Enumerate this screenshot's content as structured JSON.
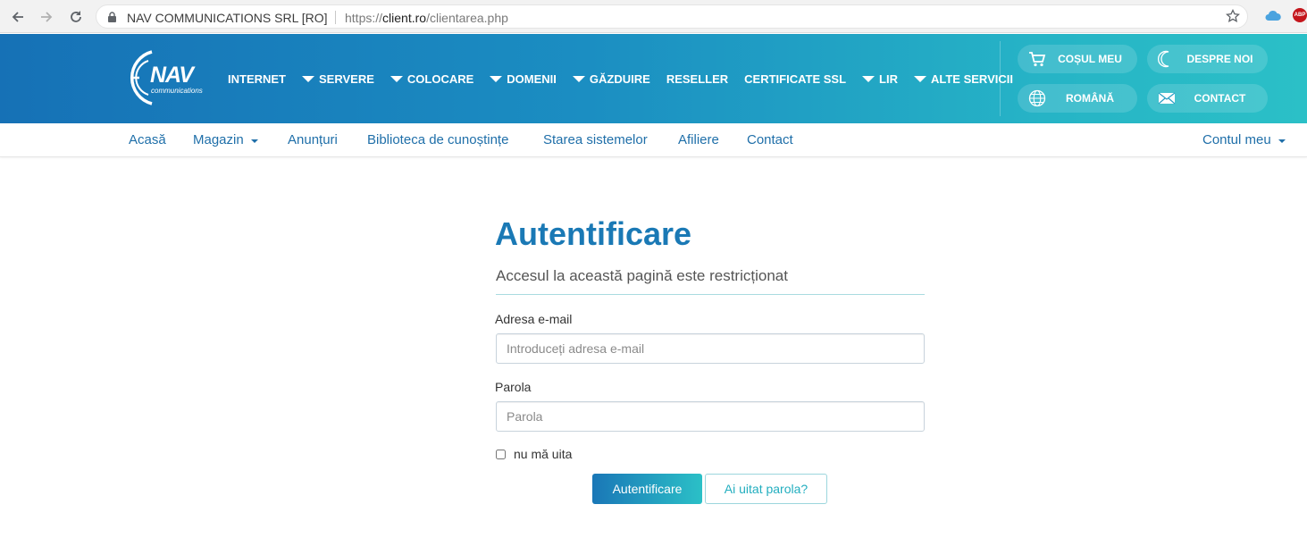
{
  "browser": {
    "site_name": "NAV COMMUNICATIONS SRL [RO]",
    "url_scheme": "https://",
    "url_host": "client.ro",
    "url_path": "/clientarea.php",
    "icons": [
      "back-arrow-icon",
      "forward-arrow-icon",
      "reload-icon",
      "lock-icon",
      "bookmark-star-icon",
      "cloud-extension-icon",
      "adblock-extension-icon"
    ],
    "abp_label": "ABP"
  },
  "header": {
    "logo_text": "NAV",
    "logo_subtext": "communications",
    "menu": [
      {
        "label": "INTERNET",
        "has_caret": false
      },
      {
        "label": "SERVERE",
        "has_caret": true
      },
      {
        "label": "COLOCARE",
        "has_caret": true
      },
      {
        "label": "DOMENII",
        "has_caret": true
      },
      {
        "label": "GĂZDUIRE",
        "has_caret": true
      },
      {
        "label": "RESELLER",
        "has_caret": false
      },
      {
        "label": "CERTIFICATE SSL",
        "has_caret": false
      },
      {
        "label": "LIR",
        "has_caret": true
      },
      {
        "label": "ALTE SERVICII",
        "has_caret": true
      }
    ],
    "pills": {
      "cart": {
        "label": "COȘUL MEU",
        "icon": "cart-icon"
      },
      "about": {
        "label": "DESPRE NOI",
        "icon": "moon-icon"
      },
      "language": {
        "label": "ROMÂNĂ",
        "icon": "globe-icon"
      },
      "contact": {
        "label": "CONTACT",
        "icon": "envelope-icon"
      }
    }
  },
  "subnav": {
    "items": [
      "Acasă",
      "Magazin",
      "Anunțuri",
      "Biblioteca de cunoștințe",
      "Starea sistemelor",
      "Afiliere",
      "Contact"
    ],
    "account": "Contul meu"
  },
  "login": {
    "title": "Autentificare",
    "subtitle": "Accesul la această pagină este restricționat",
    "email_label": "Adresa e-mail",
    "email_placeholder": "Introduceți adresa e-mail",
    "email_value": "",
    "password_label": "Parola",
    "password_placeholder": "Parola",
    "password_value": "",
    "remember_label": "nu mă uita",
    "remember_checked": false,
    "submit_label": "Autentificare",
    "forgot_label": "Ai uitat parola?"
  },
  "colors": {
    "brand_blue": "#1a79b5",
    "brand_teal": "#2bc0c7",
    "link_blue": "#1f6fa9"
  }
}
